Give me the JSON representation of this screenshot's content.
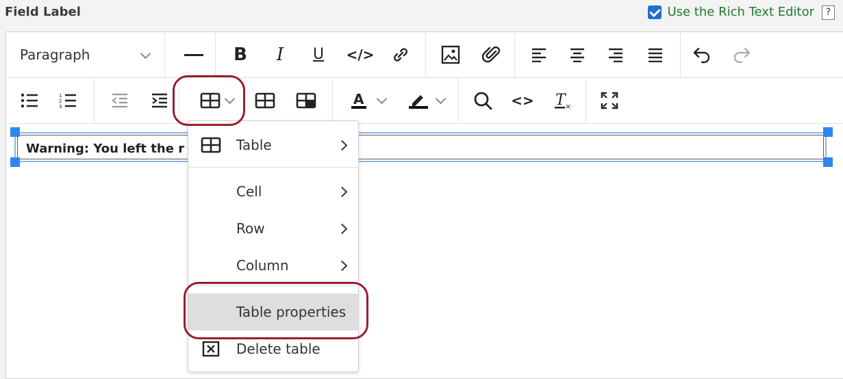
{
  "header": {
    "field_label": "Field Label",
    "rte_label": "Use the Rich Text Editor",
    "help": "?"
  },
  "toolbar": {
    "block_format": "Paragraph",
    "bold": "B",
    "italic": "I",
    "underline": "U",
    "code": "</>",
    "find": "Q",
    "source": "<>"
  },
  "editor": {
    "table_text": "Warning: You left the r"
  },
  "menu": {
    "table": "Table",
    "cell": "Cell",
    "row": "Row",
    "column": "Column",
    "table_properties": "Table properties",
    "delete_table": "Delete table"
  },
  "colors": {
    "accent_red": "#9b1c2e",
    "selection_blue": "#2f86f0",
    "rte_green": "#1f7a2e"
  }
}
